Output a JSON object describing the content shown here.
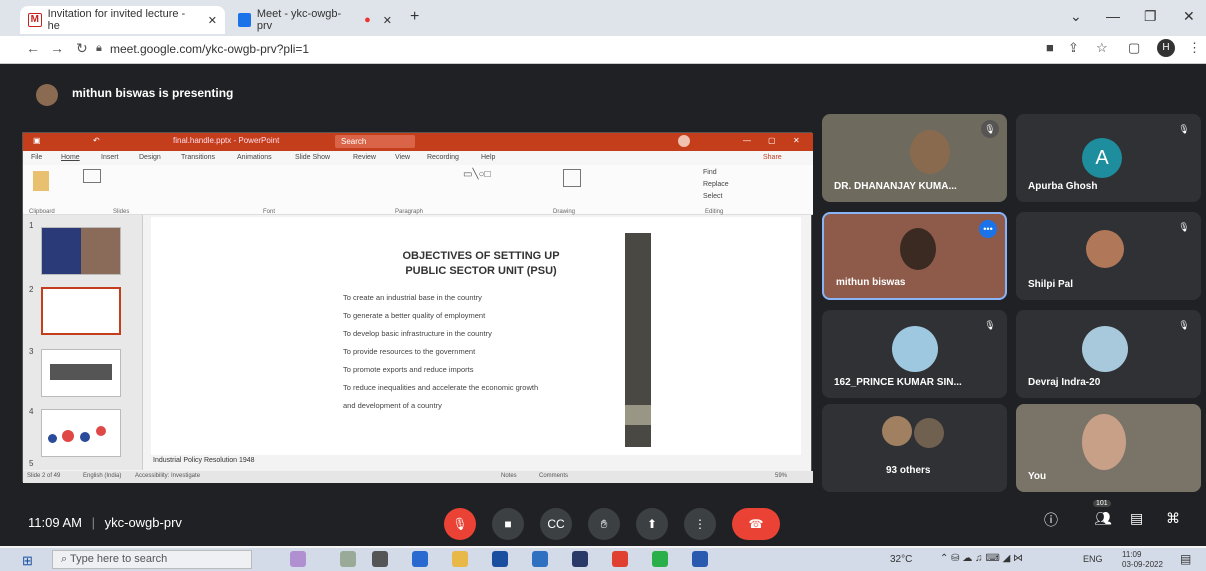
{
  "browser": {
    "tabs": [
      {
        "label": "Invitation for invited lecture - he",
        "favicon_color": "#c5221f"
      },
      {
        "label": "Meet - ykc-owgb-prv",
        "favicon_color": "#1a73e8"
      }
    ],
    "url": "meet.google.com/ykc-owgb-prv?pli=1",
    "profile_initial": "H"
  },
  "meet": {
    "presenter_label": "mithun biswas is presenting",
    "meeting_time": "11:09 AM",
    "meeting_code": "ykc-owgb-prv",
    "participant_count_badge": "101",
    "participants": [
      {
        "name": "DR. DHANANJAY KUMA...",
        "avatar_letter": ""
      },
      {
        "name": "Apurba Ghosh",
        "avatar_letter": "A"
      },
      {
        "name": "mithun biswas",
        "avatar_letter": ""
      },
      {
        "name": "Shilpi Pal",
        "avatar_letter": ""
      },
      {
        "name": "162_PRINCE KUMAR SIN...",
        "avatar_letter": ""
      },
      {
        "name": "Devraj Indra-20",
        "avatar_letter": ""
      },
      {
        "name": "93 others",
        "avatar_letter": ""
      },
      {
        "name": "You",
        "avatar_letter": ""
      }
    ]
  },
  "ppt": {
    "window_title": "final.handle.pptx - PowerPoint",
    "search_label": "Search",
    "menu": [
      "File",
      "Home",
      "Insert",
      "Design",
      "Transitions",
      "Animations",
      "Slide Show",
      "Review",
      "View",
      "Recording",
      "Help"
    ],
    "share_label": "Share",
    "ribbon_groups": [
      "Clipboard",
      "Slides",
      "Font",
      "Paragraph",
      "Drawing",
      "Editing"
    ],
    "ribbon_find": "Find",
    "ribbon_replace": "Replace",
    "ribbon_select": "Select",
    "slide_title_line1": "OBJECTIVES OF SETTING UP",
    "slide_title_line2": "PUBLIC SECTOR UNIT (PSU)",
    "bullets": [
      "To create an industrial base in the country",
      "To generate a better quality of employment",
      "To develop basic infrastructure in the country",
      "To provide resources to the government",
      "To promote exports and reduce imports",
      "To reduce inequalities and accelerate the economic growth",
      "and development of a country"
    ],
    "notes_text": "Industrial Policy Resolution 1948",
    "status_slide": "Slide 2 of 49",
    "status_lang": "English (India)",
    "status_access": "Accessibility: Investigate",
    "status_notes": "Notes",
    "status_comments": "Comments",
    "status_zoom": "59%"
  },
  "taskbar": {
    "search_placeholder": "Type here to search",
    "temperature": "32°C",
    "language": "ENG",
    "time": "11:09",
    "date": "03-09-2022"
  }
}
